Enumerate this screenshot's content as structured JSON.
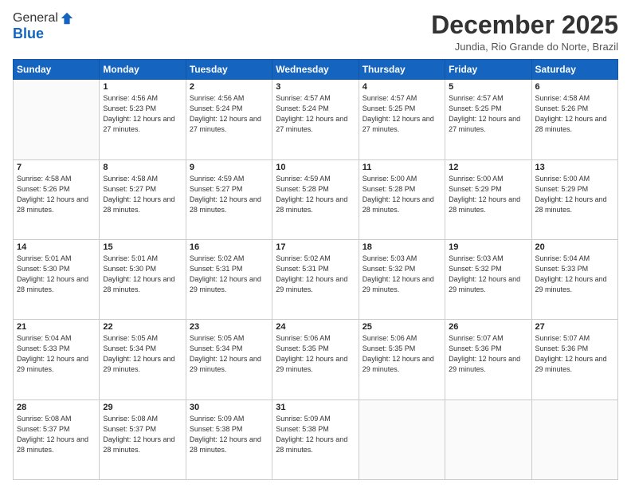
{
  "header": {
    "logo_general": "General",
    "logo_blue": "Blue",
    "month_title": "December 2025",
    "subtitle": "Jundia, Rio Grande do Norte, Brazil"
  },
  "days_of_week": [
    "Sunday",
    "Monday",
    "Tuesday",
    "Wednesday",
    "Thursday",
    "Friday",
    "Saturday"
  ],
  "weeks": [
    [
      {
        "day": "",
        "info": ""
      },
      {
        "day": "1",
        "info": "Sunrise: 4:56 AM\nSunset: 5:23 PM\nDaylight: 12 hours and 27 minutes."
      },
      {
        "day": "2",
        "info": "Sunrise: 4:56 AM\nSunset: 5:24 PM\nDaylight: 12 hours and 27 minutes."
      },
      {
        "day": "3",
        "info": "Sunrise: 4:57 AM\nSunset: 5:24 PM\nDaylight: 12 hours and 27 minutes."
      },
      {
        "day": "4",
        "info": "Sunrise: 4:57 AM\nSunset: 5:25 PM\nDaylight: 12 hours and 27 minutes."
      },
      {
        "day": "5",
        "info": "Sunrise: 4:57 AM\nSunset: 5:25 PM\nDaylight: 12 hours and 27 minutes."
      },
      {
        "day": "6",
        "info": "Sunrise: 4:58 AM\nSunset: 5:26 PM\nDaylight: 12 hours and 28 minutes."
      }
    ],
    [
      {
        "day": "7",
        "info": "Sunrise: 4:58 AM\nSunset: 5:26 PM\nDaylight: 12 hours and 28 minutes."
      },
      {
        "day": "8",
        "info": "Sunrise: 4:58 AM\nSunset: 5:27 PM\nDaylight: 12 hours and 28 minutes."
      },
      {
        "day": "9",
        "info": "Sunrise: 4:59 AM\nSunset: 5:27 PM\nDaylight: 12 hours and 28 minutes."
      },
      {
        "day": "10",
        "info": "Sunrise: 4:59 AM\nSunset: 5:28 PM\nDaylight: 12 hours and 28 minutes."
      },
      {
        "day": "11",
        "info": "Sunrise: 5:00 AM\nSunset: 5:28 PM\nDaylight: 12 hours and 28 minutes."
      },
      {
        "day": "12",
        "info": "Sunrise: 5:00 AM\nSunset: 5:29 PM\nDaylight: 12 hours and 28 minutes."
      },
      {
        "day": "13",
        "info": "Sunrise: 5:00 AM\nSunset: 5:29 PM\nDaylight: 12 hours and 28 minutes."
      }
    ],
    [
      {
        "day": "14",
        "info": "Sunrise: 5:01 AM\nSunset: 5:30 PM\nDaylight: 12 hours and 28 minutes."
      },
      {
        "day": "15",
        "info": "Sunrise: 5:01 AM\nSunset: 5:30 PM\nDaylight: 12 hours and 28 minutes."
      },
      {
        "day": "16",
        "info": "Sunrise: 5:02 AM\nSunset: 5:31 PM\nDaylight: 12 hours and 29 minutes."
      },
      {
        "day": "17",
        "info": "Sunrise: 5:02 AM\nSunset: 5:31 PM\nDaylight: 12 hours and 29 minutes."
      },
      {
        "day": "18",
        "info": "Sunrise: 5:03 AM\nSunset: 5:32 PM\nDaylight: 12 hours and 29 minutes."
      },
      {
        "day": "19",
        "info": "Sunrise: 5:03 AM\nSunset: 5:32 PM\nDaylight: 12 hours and 29 minutes."
      },
      {
        "day": "20",
        "info": "Sunrise: 5:04 AM\nSunset: 5:33 PM\nDaylight: 12 hours and 29 minutes."
      }
    ],
    [
      {
        "day": "21",
        "info": "Sunrise: 5:04 AM\nSunset: 5:33 PM\nDaylight: 12 hours and 29 minutes."
      },
      {
        "day": "22",
        "info": "Sunrise: 5:05 AM\nSunset: 5:34 PM\nDaylight: 12 hours and 29 minutes."
      },
      {
        "day": "23",
        "info": "Sunrise: 5:05 AM\nSunset: 5:34 PM\nDaylight: 12 hours and 29 minutes."
      },
      {
        "day": "24",
        "info": "Sunrise: 5:06 AM\nSunset: 5:35 PM\nDaylight: 12 hours and 29 minutes."
      },
      {
        "day": "25",
        "info": "Sunrise: 5:06 AM\nSunset: 5:35 PM\nDaylight: 12 hours and 29 minutes."
      },
      {
        "day": "26",
        "info": "Sunrise: 5:07 AM\nSunset: 5:36 PM\nDaylight: 12 hours and 29 minutes."
      },
      {
        "day": "27",
        "info": "Sunrise: 5:07 AM\nSunset: 5:36 PM\nDaylight: 12 hours and 29 minutes."
      }
    ],
    [
      {
        "day": "28",
        "info": "Sunrise: 5:08 AM\nSunset: 5:37 PM\nDaylight: 12 hours and 28 minutes."
      },
      {
        "day": "29",
        "info": "Sunrise: 5:08 AM\nSunset: 5:37 PM\nDaylight: 12 hours and 28 minutes."
      },
      {
        "day": "30",
        "info": "Sunrise: 5:09 AM\nSunset: 5:38 PM\nDaylight: 12 hours and 28 minutes."
      },
      {
        "day": "31",
        "info": "Sunrise: 5:09 AM\nSunset: 5:38 PM\nDaylight: 12 hours and 28 minutes."
      },
      {
        "day": "",
        "info": ""
      },
      {
        "day": "",
        "info": ""
      },
      {
        "day": "",
        "info": ""
      }
    ]
  ]
}
